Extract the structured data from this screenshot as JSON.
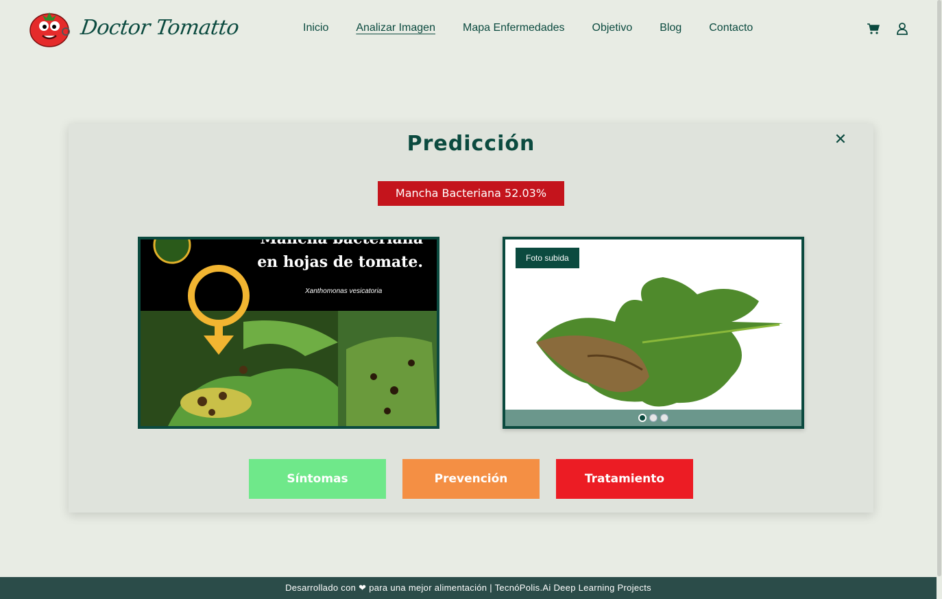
{
  "brand": {
    "name": "Doctor Tomatto"
  },
  "nav": {
    "items": [
      {
        "label": "Inicio"
      },
      {
        "label": "Analizar Imagen",
        "active": true
      },
      {
        "label": "Mapa Enfermedades"
      },
      {
        "label": "Objetivo"
      },
      {
        "label": "Blog"
      },
      {
        "label": "Contacto"
      }
    ]
  },
  "header_icons": [
    "cart-icon",
    "user-icon"
  ],
  "modal": {
    "title": "Predicción",
    "close_icon": "close-icon",
    "prediction": {
      "label": "Mancha Bacteriana 52.03%",
      "color": "#c4141c"
    },
    "info_image": {
      "title_line1": "Mancha bacteriana",
      "title_line2": "en hojas de tomate.",
      "subtitle": "Xanthomonas vesicatoria"
    },
    "uploaded_photo": {
      "tag": "Foto subida",
      "slides": 3,
      "active_slide": 1
    },
    "buttons": {
      "sintomas": "Síntomas",
      "prevencion": "Prevención",
      "tratamiento": "Tratamiento"
    }
  },
  "colors": {
    "primary": "#0b4a3f",
    "background": "#e8ece4",
    "sintomas": "#6fe88a",
    "prevencion": "#f48f44",
    "tratamiento": "#ec1c24"
  },
  "footer": {
    "text_before": "Desarrollado con",
    "text_after": "para una mejor alimentación | TecnóPolis.Ai Deep Learning Projects"
  }
}
